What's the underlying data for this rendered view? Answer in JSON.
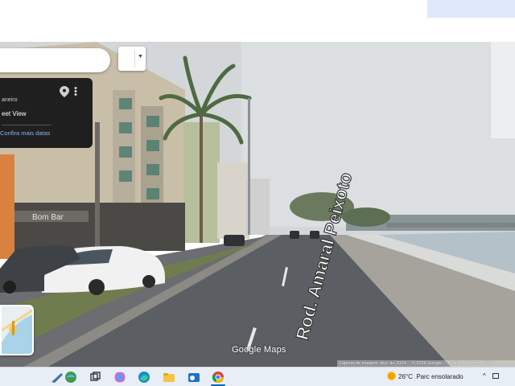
{
  "search": {
    "placeholder": ""
  },
  "info_card": {
    "location_partial": "aneiro",
    "view_label": "eet View",
    "more_dates_link": "Confira mais datas"
  },
  "road_text": "Rod. Amaral Peixoto",
  "watermark": "Google Maps",
  "attribution": {
    "capture": "Captura de imagem: dez. de 2024",
    "copyright": "© 2026 Google",
    "country": "Brasil",
    "terms": "Termos",
    "privacy": "Pri"
  },
  "shop_sign": "Bom Bar",
  "taskbar": {
    "weather_temp": "26°C",
    "weather_desc": "Parc ensolarado",
    "tray_chevron": "^"
  },
  "colors": {
    "sky": "#d8dadb",
    "asphalt": "#5f6266",
    "water": "#b9c5cc",
    "card_bg": "#1f1f1f",
    "link": "#8ab4f8"
  }
}
